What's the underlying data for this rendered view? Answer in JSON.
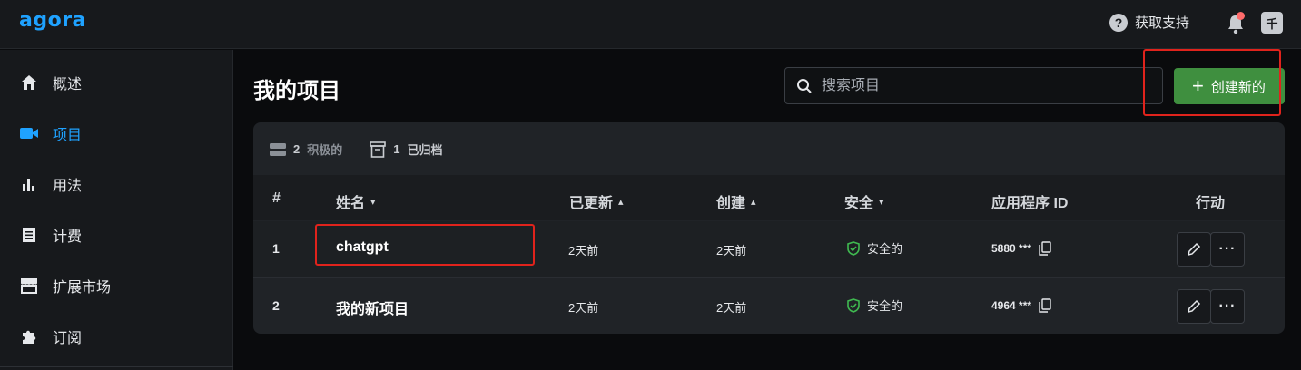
{
  "header": {
    "logo": "agora",
    "help_label": "获取支持",
    "help_icon": "?",
    "avatar": "千"
  },
  "sidebar": {
    "items": [
      {
        "label": "概述",
        "icon": "home-icon"
      },
      {
        "label": "项目",
        "icon": "video-camera-icon",
        "active": true
      },
      {
        "label": "用法",
        "icon": "bar-chart-icon"
      },
      {
        "label": "计费",
        "icon": "receipt-icon"
      },
      {
        "label": "扩展市场",
        "icon": "store-icon"
      },
      {
        "label": "订阅",
        "icon": "puzzle-icon"
      }
    ]
  },
  "main": {
    "title": "我的项目",
    "search_placeholder": "搜索项目",
    "create_label": "创建新的",
    "stats": {
      "active_count": "2",
      "active_label": "积极的",
      "archived_count": "1",
      "archived_label": "已归档"
    },
    "table": {
      "headers": [
        "#",
        "姓名",
        "已更新",
        "创建",
        "安全",
        "应用程序 ID",
        "行动"
      ],
      "header_sort": [
        "",
        "▾",
        "▴",
        "▴",
        "▾",
        "",
        ""
      ],
      "rows": [
        {
          "index": "1",
          "name": "chatgpt",
          "updated": "2天前",
          "created": "2天前",
          "security": "安全的",
          "app_id": "5880 ***"
        },
        {
          "index": "2",
          "name": "我的新项目",
          "updated": "2天前",
          "created": "2天前",
          "security": "安全的",
          "app_id": "4964 ***"
        }
      ]
    }
  },
  "colors": {
    "accent": "#1fa2ff",
    "create_button": "#3f8f3f",
    "highlight": "#e0231c",
    "secure": "#3fb950"
  }
}
